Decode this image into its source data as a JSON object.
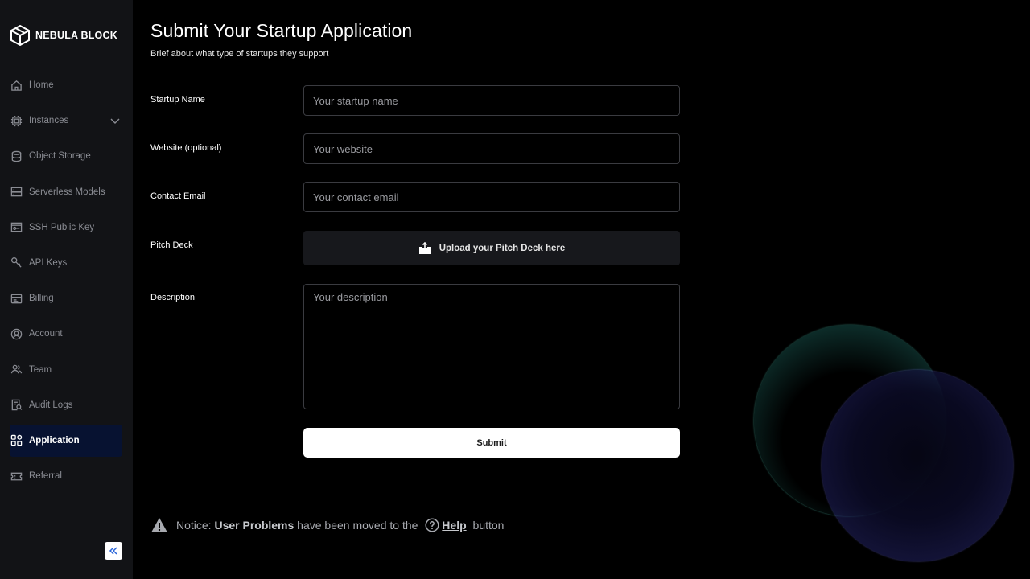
{
  "brand": {
    "name": "NEBULA BLOCK"
  },
  "sidebar": {
    "items": [
      {
        "label": "Home",
        "icon": "home-icon"
      },
      {
        "label": "Instances",
        "icon": "chip-icon",
        "expandable": true
      },
      {
        "label": "Object Storage",
        "icon": "database-icon"
      },
      {
        "label": "Serverless Models",
        "icon": "server-icon"
      },
      {
        "label": "SSH Public Key",
        "icon": "ssh-key-icon"
      },
      {
        "label": "API Keys",
        "icon": "key-icon"
      },
      {
        "label": "Billing",
        "icon": "billing-icon"
      },
      {
        "label": "Account",
        "icon": "account-icon"
      },
      {
        "label": "Team",
        "icon": "team-icon"
      },
      {
        "label": "Audit Logs",
        "icon": "audit-log-icon"
      },
      {
        "label": "Application",
        "icon": "grid-icon",
        "active": true
      },
      {
        "label": "Referral",
        "icon": "ticket-icon"
      }
    ]
  },
  "main": {
    "title": "Submit Your Startup Application",
    "subtitle": "Brief about what type of startups they support",
    "form": {
      "startup_name": {
        "label": "Startup Name",
        "placeholder": "Your startup name"
      },
      "website": {
        "label": "Website (optional)",
        "placeholder": "Your website"
      },
      "contact_email": {
        "label": "Contact Email",
        "placeholder": "Your contact email"
      },
      "pitch_deck": {
        "label": "Pitch Deck",
        "button": "Upload your Pitch Deck here"
      },
      "description": {
        "label": "Description",
        "placeholder": "Your description"
      },
      "submit": "Submit"
    },
    "notice": {
      "prefix": "Notice: ",
      "highlight": "User Problems",
      "middle": " have been moved to the ",
      "link": "Help",
      "suffix": " button"
    }
  },
  "colors": {
    "sidebar_bg": "#121316",
    "active_item_bg": "#071231",
    "accent": "#2b66d9"
  }
}
